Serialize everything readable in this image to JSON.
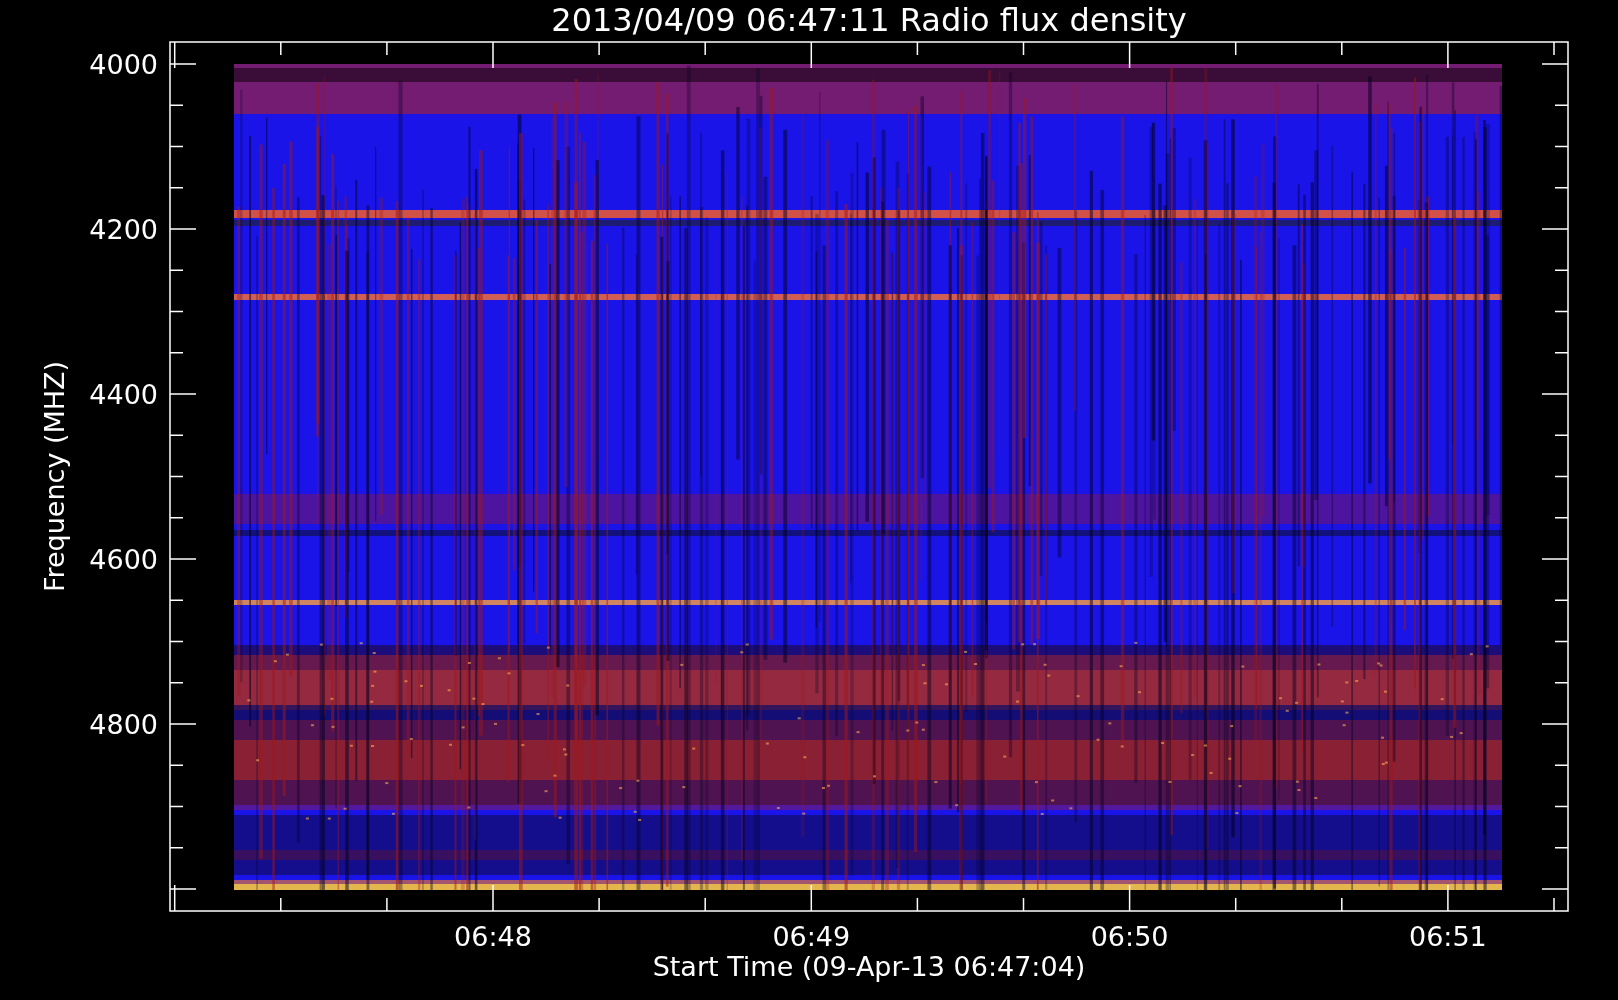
{
  "title": "2013/04/09 06:47:11 Radio flux density",
  "y_axis": {
    "label": "Frequency (MHZ)",
    "ticks": [
      "4000",
      "4200",
      "4400",
      "4600",
      "4800"
    ]
  },
  "x_axis": {
    "label": "Start Time (09-Apr-13 06:47:04)",
    "ticks": [
      "06:48",
      "06:49",
      "06:50",
      "06:51"
    ]
  }
}
